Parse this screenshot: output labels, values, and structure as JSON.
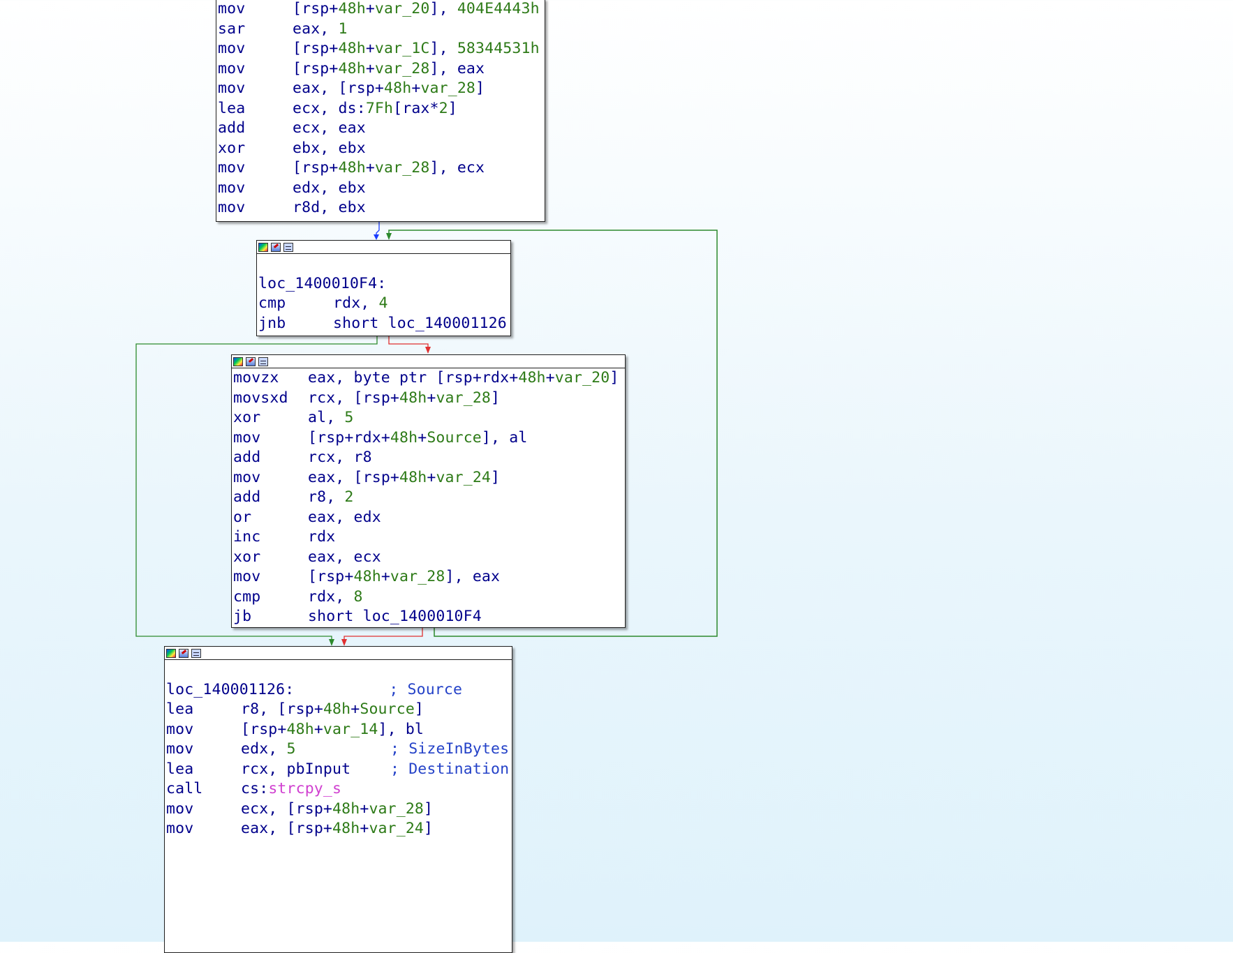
{
  "colors": {
    "edge_true": "#2d8a2d",
    "edge_false": "#e03030",
    "edge_normal": "#1a3cff",
    "mnemonic": "#00008b",
    "number": "#2d7a17",
    "comment": "#2442c8",
    "import": "#d040d0"
  },
  "block1": {
    "lines": [
      {
        "mn": "mov",
        "op": "[rsp+48h+var_20], 404E4443h"
      },
      {
        "mn": "sar",
        "op": "eax, 1"
      },
      {
        "mn": "mov",
        "op": "[rsp+48h+var_1C], 58344531h"
      },
      {
        "mn": "mov",
        "op": "[rsp+48h+var_28], eax"
      },
      {
        "mn": "mov",
        "op": "eax, [rsp+48h+var_28]"
      },
      {
        "mn": "lea",
        "op": "ecx, ds:7Fh[rax*2]"
      },
      {
        "mn": "add",
        "op": "ecx, eax"
      },
      {
        "mn": "xor",
        "op": "ebx, ebx"
      },
      {
        "mn": "mov",
        "op": "[rsp+48h+var_28], ecx"
      },
      {
        "mn": "mov",
        "op": "edx, ebx"
      },
      {
        "mn": "mov",
        "op": "r8d, ebx"
      }
    ]
  },
  "block2": {
    "label": "loc_1400010F4:",
    "lines": [
      {
        "mn": "cmp",
        "op": "rdx, 4"
      },
      {
        "mn": "jnb",
        "op": "short loc_140001126"
      }
    ]
  },
  "block3": {
    "lines": [
      {
        "mn": "movzx",
        "op": "eax, byte ptr [rsp+rdx+48h+var_20]"
      },
      {
        "mn": "movsxd",
        "op": "rcx, [rsp+48h+var_28]"
      },
      {
        "mn": "xor",
        "op": "al, 5"
      },
      {
        "mn": "mov",
        "op": "[rsp+rdx+48h+Source], al"
      },
      {
        "mn": "add",
        "op": "rcx, r8"
      },
      {
        "mn": "mov",
        "op": "eax, [rsp+48h+var_24]"
      },
      {
        "mn": "add",
        "op": "r8, 2"
      },
      {
        "mn": "or",
        "op": "eax, edx"
      },
      {
        "mn": "inc",
        "op": "rdx"
      },
      {
        "mn": "xor",
        "op": "eax, ecx"
      },
      {
        "mn": "mov",
        "op": "[rsp+48h+var_28], eax"
      },
      {
        "mn": "cmp",
        "op": "rdx, 8"
      },
      {
        "mn": "jb",
        "op": "short loc_1400010F4"
      }
    ]
  },
  "block4": {
    "label": "loc_140001126:",
    "label_comment": "; Source",
    "lines": [
      {
        "mn": "lea",
        "op": "r8, [rsp+48h+Source]",
        "comment": ""
      },
      {
        "mn": "mov",
        "op": "[rsp+48h+var_14], bl",
        "comment": ""
      },
      {
        "mn": "mov",
        "op": "edx, 5",
        "comment": "; SizeInBytes"
      },
      {
        "mn": "lea",
        "op": "rcx, pbInput",
        "comment": "; Destination"
      },
      {
        "mn": "call",
        "op": "cs:strcpy_s",
        "comment": ""
      },
      {
        "mn": "mov",
        "op": "ecx, [rsp+48h+var_28]",
        "comment": ""
      },
      {
        "mn": "mov",
        "op": "eax, [rsp+48h+var_24]",
        "comment": ""
      }
    ]
  }
}
